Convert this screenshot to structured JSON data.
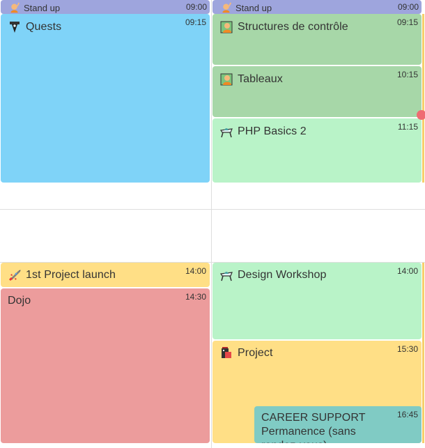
{
  "colors": {
    "standup": "#9ea5dd",
    "quests": "#7fd3f8",
    "structures": "#a7d7a8",
    "tableaux": "#a7d7a8",
    "php": "#b9f3c8",
    "launch": "#ffdf86",
    "dojo": "#ec9c9c",
    "design": "#b9f3c8",
    "project": "#ffdf86",
    "career": "#80cbc4",
    "now_marker": "#ef6b72"
  },
  "columns": [
    {
      "standup": {
        "title": "Stand up",
        "time": "09:00",
        "icon": "person-raising-hand-icon"
      },
      "events": [
        {
          "id": "quests",
          "title": "Quests",
          "time": "09:15",
          "icon": "quest-totem-icon"
        },
        {
          "id": "launch",
          "title": "1st Project launch",
          "time": "14:00",
          "icon": "rocket-icon"
        },
        {
          "id": "dojo",
          "title": "Dojo",
          "time": "14:30",
          "icon": ""
        }
      ]
    },
    {
      "standup": {
        "title": "Stand up",
        "time": "09:00",
        "icon": "person-raising-hand-icon"
      },
      "events": [
        {
          "id": "structures",
          "title": "Structures de contrôle",
          "time": "09:15",
          "icon": "teacher-icon"
        },
        {
          "id": "tableaux",
          "title": "Tableaux",
          "time": "10:15",
          "icon": "teacher-icon"
        },
        {
          "id": "php",
          "title": "PHP Basics 2",
          "time": "11:15",
          "icon": "workshop-icon"
        },
        {
          "id": "design",
          "title": "Design Workshop",
          "time": "14:00",
          "icon": "workshop-icon"
        },
        {
          "id": "project",
          "title": "Project",
          "time": "15:30",
          "icon": "project-icon"
        },
        {
          "id": "career",
          "title": "CAREER SUPPORT Permanence (sans rendez-vous)",
          "time": "16:45",
          "icon": ""
        }
      ]
    }
  ]
}
